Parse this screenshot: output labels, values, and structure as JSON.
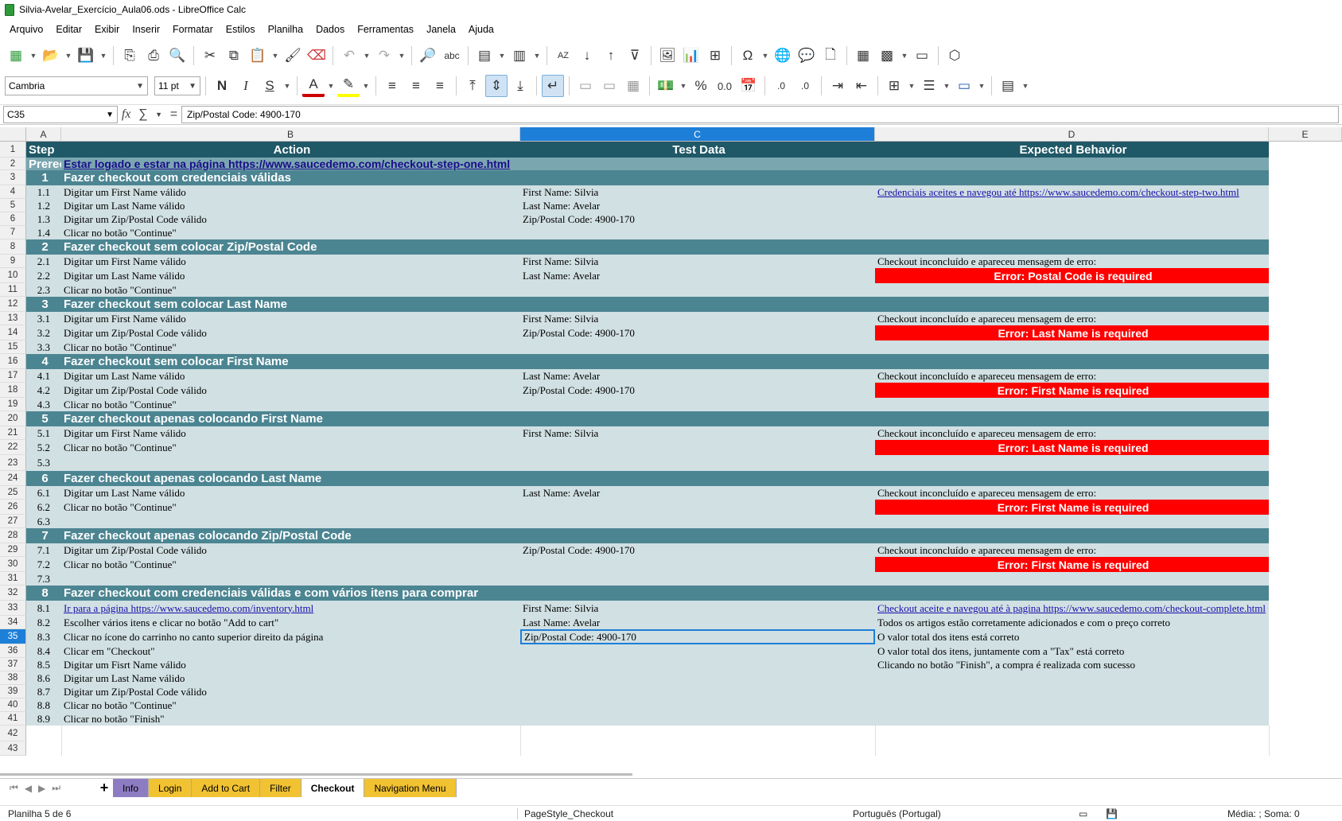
{
  "window_title": "Silvia-Avelar_Exercício_Aula06.ods - LibreOffice Calc",
  "menu": [
    "Arquivo",
    "Editar",
    "Exibir",
    "Inserir",
    "Formatar",
    "Estilos",
    "Planilha",
    "Dados",
    "Ferramentas",
    "Janela",
    "Ajuda"
  ],
  "font_name": "Cambria",
  "font_size": "11 pt",
  "name_box": "C35",
  "formula": "Zip/Postal Code: 4900-170",
  "columns": [
    "A",
    "B",
    "C",
    "D",
    "E"
  ],
  "rows": [
    {
      "n": "1",
      "type": "header",
      "a": "Step",
      "b": "Action",
      "c": "Test Data",
      "d": "Expected Behavior"
    },
    {
      "n": "2",
      "type": "pre",
      "a": "Prerec",
      "b": "Estar logado e estar na página https://www.saucedemo.com/checkout-step-one.html",
      "c": "",
      "d": ""
    },
    {
      "n": "3",
      "type": "section",
      "a": "1",
      "b": "Fazer  checkout com credenciais válidas",
      "c": "",
      "d": ""
    },
    {
      "n": "4",
      "type": "step",
      "a": "1.1",
      "b": "Digitar um First Name válido",
      "c": "First Name: Silvia",
      "d": "Credenciais aceites e navegou até https://www.saucedemo.com/checkout-step-two.html",
      "d_link": true
    },
    {
      "n": "5",
      "type": "step",
      "a": "1.2",
      "b": "Digitar um Last Name válido",
      "c": "Last Name: Avelar",
      "d": ""
    },
    {
      "n": "6",
      "type": "step",
      "a": "1.3",
      "b": "Digitar um Zip/Postal Code válido",
      "c": "Zip/Postal Code: 4900-170",
      "d": ""
    },
    {
      "n": "7",
      "type": "step",
      "a": "1.4",
      "b": "Clicar no botão \"Continue\"",
      "c": "",
      "d": ""
    },
    {
      "n": "8",
      "type": "section",
      "a": "2",
      "b": "Fazer checkout sem colocar Zip/Postal Code",
      "c": "",
      "d": ""
    },
    {
      "n": "9",
      "type": "step",
      "a": "2.1",
      "b": "Digitar um First Name válido",
      "c": "First Name: Silvia",
      "d": "Checkout inconcluído e apareceu mensagem de erro:"
    },
    {
      "n": "10",
      "type": "step",
      "a": "2.2",
      "b": "Digitar um Last Name válido",
      "c": "Last Name: Avelar",
      "d": "Error: Postal Code is required",
      "d_error": true
    },
    {
      "n": "11",
      "type": "step",
      "a": "2.3",
      "b": "Clicar no botão \"Continue\"",
      "c": "",
      "d": ""
    },
    {
      "n": "12",
      "type": "section",
      "a": "3",
      "b": "Fazer checkout sem colocar Last Name",
      "c": "",
      "d": ""
    },
    {
      "n": "13",
      "type": "step",
      "a": "3.1",
      "b": "Digitar um First Name válido",
      "c": "First Name: Silvia",
      "d": "Checkout inconcluído e apareceu mensagem de erro:"
    },
    {
      "n": "14",
      "type": "step",
      "a": "3.2",
      "b": "Digitar um Zip/Postal Code válido",
      "c": "Zip/Postal Code: 4900-170",
      "d": "Error: Last Name is required",
      "d_error": true
    },
    {
      "n": "15",
      "type": "step",
      "a": "3.3",
      "b": "Clicar no botão \"Continue\"",
      "c": "",
      "d": ""
    },
    {
      "n": "16",
      "type": "section",
      "a": "4",
      "b": "Fazer checkout sem colocar First Name",
      "c": "",
      "d": ""
    },
    {
      "n": "17",
      "type": "step",
      "a": "4.1",
      "b": "Digitar um Last Name válido",
      "c": "Last Name: Avelar",
      "d": "Checkout inconcluído e apareceu mensagem de erro:"
    },
    {
      "n": "18",
      "type": "step",
      "a": "4.2",
      "b": "Digitar um Zip/Postal Code válido",
      "c": "Zip/Postal Code: 4900-170",
      "d": "Error: First Name is required",
      "d_error": true
    },
    {
      "n": "19",
      "type": "step",
      "a": "4.3",
      "b": "Clicar no botão \"Continue\"",
      "c": "",
      "d": ""
    },
    {
      "n": "20",
      "type": "section",
      "a": "5",
      "b": "Fazer checkout apenas colocando First Name",
      "c": "",
      "d": ""
    },
    {
      "n": "21",
      "type": "step",
      "a": "5.1",
      "b": "Digitar um First Name válido",
      "c": "First Name: Silvia",
      "d": "Checkout inconcluído e apareceu mensagem de erro:"
    },
    {
      "n": "22",
      "type": "step",
      "a": "5.2",
      "b": "Clicar no botão \"Continue\"",
      "c": "",
      "d": "Error: Last Name is required",
      "d_error": true
    },
    {
      "n": "23",
      "type": "step",
      "a": "5.3",
      "b": "",
      "c": "",
      "d": ""
    },
    {
      "n": "24",
      "type": "section",
      "a": "6",
      "b": "Fazer checkout apenas colocando Last Name",
      "c": "",
      "d": ""
    },
    {
      "n": "25",
      "type": "step",
      "a": "6.1",
      "b": "Digitar um Last Name válido",
      "c": "Last Name: Avelar",
      "d": "Checkout inconcluído e apareceu mensagem de erro:"
    },
    {
      "n": "26",
      "type": "step",
      "a": "6.2",
      "b": "Clicar no botão \"Continue\"",
      "c": "",
      "d": "Error: First Name is required",
      "d_error": true
    },
    {
      "n": "27",
      "type": "step",
      "a": "6.3",
      "b": "",
      "c": "",
      "d": ""
    },
    {
      "n": "28",
      "type": "section",
      "a": "7",
      "b": "Fazer checkout apenas colocando Zip/Postal Code",
      "c": "",
      "d": ""
    },
    {
      "n": "29",
      "type": "step",
      "a": "7.1",
      "b": "Digitar um Zip/Postal Code válido",
      "c": "Zip/Postal Code: 4900-170",
      "d": "Checkout inconcluído e apareceu mensagem de erro:"
    },
    {
      "n": "30",
      "type": "step",
      "a": "7.2",
      "b": "Clicar no botão \"Continue\"",
      "c": "",
      "d": "Error: First Name is required",
      "d_error": true
    },
    {
      "n": "31",
      "type": "step",
      "a": "7.3",
      "b": "",
      "c": "",
      "d": ""
    },
    {
      "n": "32",
      "type": "section",
      "a": "8",
      "b": "Fazer checkout com credenciais válidas e com vários itens para comprar",
      "c": "",
      "d": ""
    },
    {
      "n": "33",
      "type": "step",
      "a": "8.1",
      "b": "Ir para a página https://www.saucedemo.com/inventory.html",
      "b_link": true,
      "c": "First Name: Silvia",
      "d": "Checkout aceite e navegou até à pagina https://www.saucedemo.com/checkout-complete.html",
      "d_link": true
    },
    {
      "n": "34",
      "type": "step",
      "a": "8.2",
      "b": "Escolher vários itens e clicar no botão \"Add to cart\"",
      "c": "Last Name: Avelar",
      "d": "Todos os artigos estão corretamente adicionados e com o preço correto"
    },
    {
      "n": "35",
      "type": "step",
      "a": "8.3",
      "b": "Clicar no ícone do carrinho no canto superior direito da página",
      "c": "Zip/Postal Code: 4900-170",
      "c_cursor": true,
      "d": "O valor total dos itens está correto"
    },
    {
      "n": "36",
      "type": "step",
      "a": "8.4",
      "b": "Clicar em \"Checkout\"",
      "c": "",
      "d": "O valor total dos itens, juntamente com a \"Tax\" está correto"
    },
    {
      "n": "37",
      "type": "step",
      "a": "8.5",
      "b": "Digitar um Fisrt Name válido",
      "c": "",
      "d": "Clicando no botão \"Finish\", a compra é realizada com sucesso"
    },
    {
      "n": "38",
      "type": "step",
      "a": "8.6",
      "b": "Digitar um Last Name válido",
      "c": "",
      "d": ""
    },
    {
      "n": "39",
      "type": "step",
      "a": "8.7",
      "b": "Digitar um Zip/Postal Code válido",
      "c": "",
      "d": ""
    },
    {
      "n": "40",
      "type": "step",
      "a": "8.8",
      "b": "Clicar no botão \"Continue\"",
      "c": "",
      "d": ""
    },
    {
      "n": "41",
      "type": "step",
      "a": "8.9",
      "b": "Clicar no botão \"Finish\"",
      "c": "",
      "d": ""
    },
    {
      "n": "42",
      "type": "empty",
      "a": "",
      "b": "",
      "c": "",
      "d": ""
    },
    {
      "n": "43",
      "type": "empty",
      "a": "",
      "b": "",
      "c": "",
      "d": ""
    }
  ],
  "sheet_tabs": [
    {
      "label": "Info",
      "color": "#8e7cc3"
    },
    {
      "label": "Login",
      "color": "#f1c232"
    },
    {
      "label": "Add to Cart",
      "color": "#f1c232"
    },
    {
      "label": "Filter",
      "color": "#f1c232"
    },
    {
      "label": "Checkout",
      "color": "#ffffff",
      "active": true
    },
    {
      "label": "Navigation Menu",
      "color": "#f1c232"
    }
  ],
  "status": {
    "sheet": "Planilha 5 de 6",
    "page_style": "PageStyle_Checkout",
    "language": "Português (Portugal)",
    "summary": "Média: ; Soma: 0"
  },
  "colors": {
    "header_bg": "#1f5866",
    "section_bg": "#4c8592",
    "row_bg": "#d1e0e3",
    "error_bg": "#ff0000",
    "selection": "#1e7fd8"
  }
}
